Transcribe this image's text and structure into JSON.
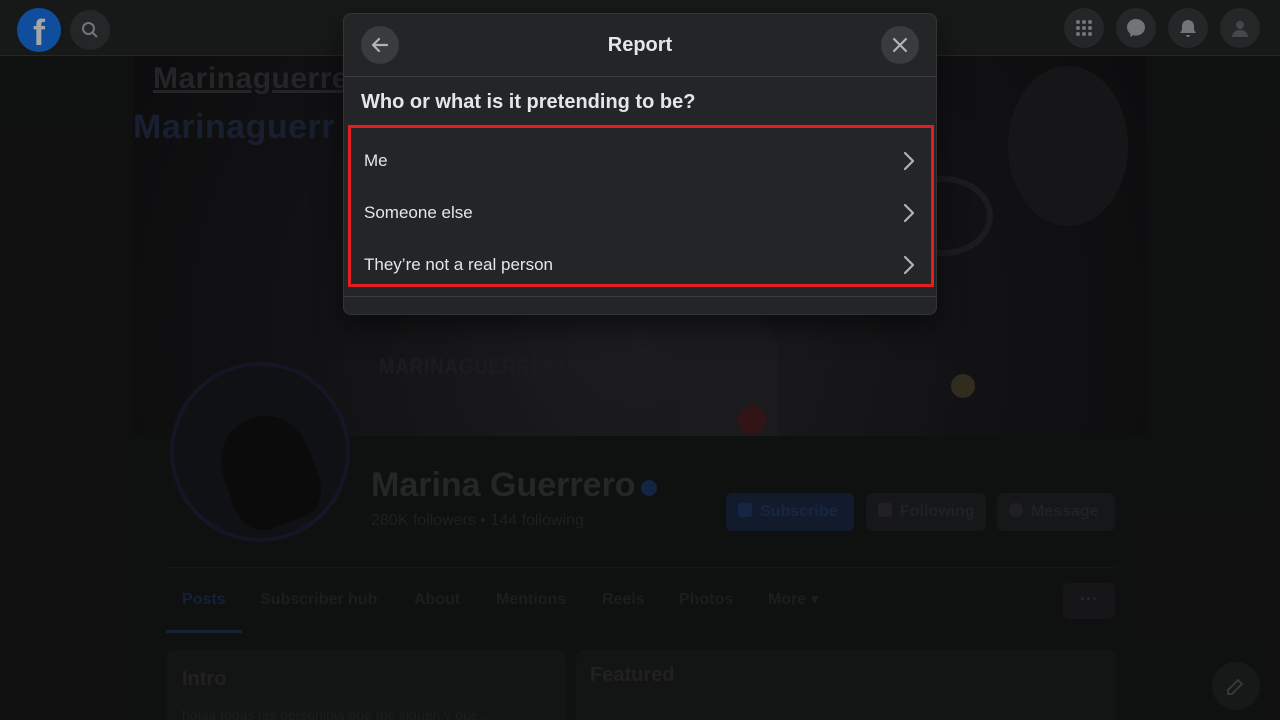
{
  "dialog": {
    "title": "Report",
    "question": "Who or what is it pretending to be?",
    "options": [
      {
        "label": "Me"
      },
      {
        "label": "Someone else"
      },
      {
        "label": "They’re not a real person"
      }
    ],
    "highlight_color": "#e41e1e"
  },
  "background": {
    "logo": "f",
    "cover": {
      "title_top": "Marinaguerre",
      "title_bottom": "Marinaguerr",
      "brand": "MARINAGUERREROFICIAL"
    },
    "profile": {
      "name": "Marina Guerrero",
      "stats": "280K followers • 144 following",
      "buttons": {
        "subscribe": "Subscribe",
        "following": "Following",
        "message": "Message"
      }
    },
    "tabs": [
      "Posts",
      "Subscriber hub",
      "About",
      "Mentions",
      "Reels",
      "Photos",
      "More ▾"
    ],
    "more_button": "···",
    "intro": {
      "title": "Intro",
      "text": "holaa todas las personitas que me siguen y que..."
    },
    "featured": {
      "title": "Featured"
    }
  },
  "colors": {
    "dialog_bg": "#242526",
    "text_primary": "#e4e6eb",
    "facebook_blue": "#1877f2"
  },
  "icons": {
    "back": "arrow-left-icon",
    "close": "close-icon",
    "chevron": "chevron-right-icon"
  }
}
